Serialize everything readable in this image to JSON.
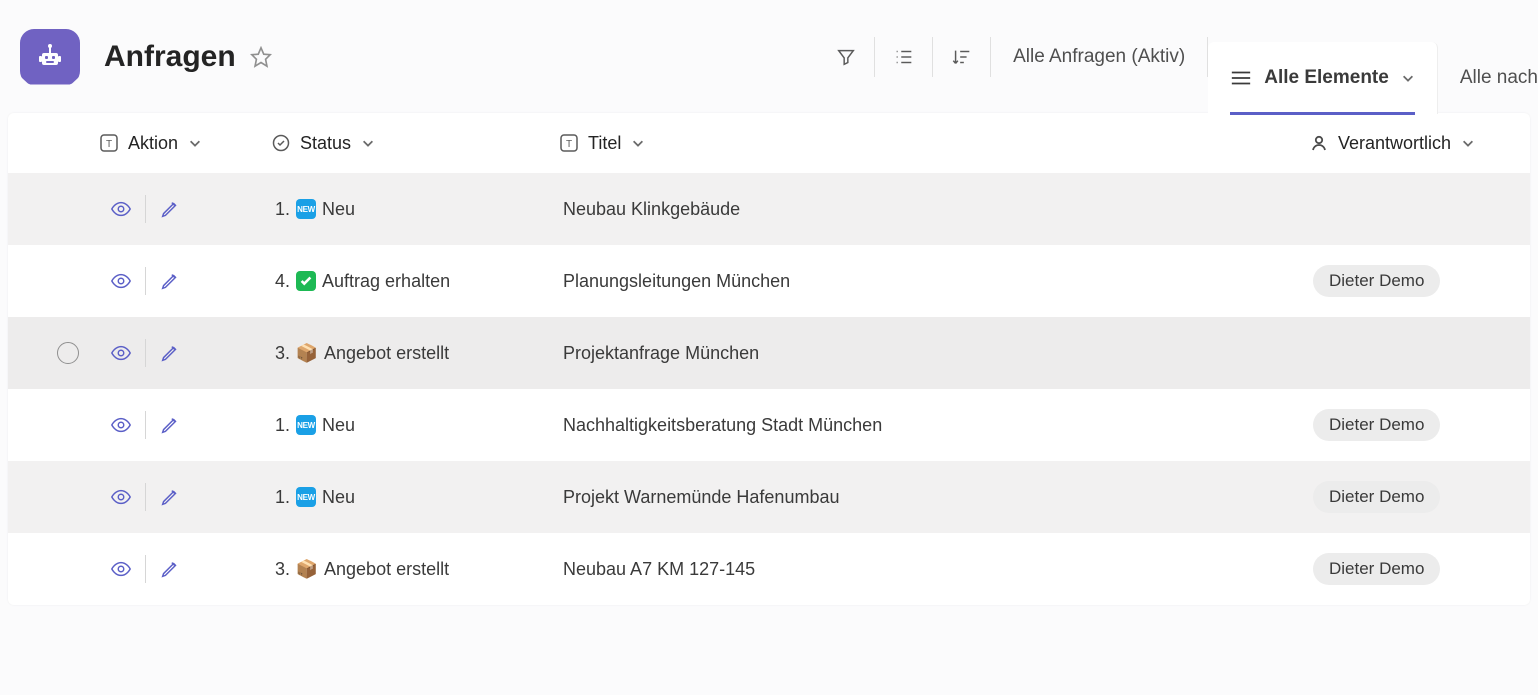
{
  "header": {
    "title": "Anfragen"
  },
  "toolbar": {
    "view_filter_label": "Alle Anfragen (Aktiv)",
    "active_tab_label": "Alle Elemente",
    "secondary_tab_label": "Alle nach "
  },
  "columns": {
    "aktion": "Aktion",
    "status": "Status",
    "titel": "Titel",
    "verantwortlich": "Verantwortlich"
  },
  "rows": [
    {
      "status_num": "1.",
      "status_kind": "neu",
      "status_label": "Neu",
      "titel": "Neubau Klinkgebäude",
      "verantwortlich": "",
      "alt": true,
      "hover": false
    },
    {
      "status_num": "4.",
      "status_kind": "auftrag",
      "status_label": "Auftrag erhalten",
      "titel": "Planungsleitungen München",
      "verantwortlich": "Dieter Demo",
      "alt": false,
      "hover": false
    },
    {
      "status_num": "3.",
      "status_kind": "angebot",
      "status_label": "Angebot erstellt",
      "titel": "Projektanfrage München",
      "verantwortlich": "",
      "alt": true,
      "hover": true
    },
    {
      "status_num": "1.",
      "status_kind": "neu",
      "status_label": "Neu",
      "titel": "Nachhaltigkeitsberatung Stadt München",
      "verantwortlich": "Dieter Demo",
      "alt": false,
      "hover": false
    },
    {
      "status_num": "1.",
      "status_kind": "neu",
      "status_label": "Neu",
      "titel": "Projekt Warnemünde Hafenumbau",
      "verantwortlich": "Dieter Demo",
      "alt": true,
      "hover": false
    },
    {
      "status_num": "3.",
      "status_kind": "angebot",
      "status_label": "Angebot erstellt",
      "titel": "Neubau A7 KM 127-145",
      "verantwortlich": "Dieter Demo",
      "alt": false,
      "hover": false
    }
  ]
}
